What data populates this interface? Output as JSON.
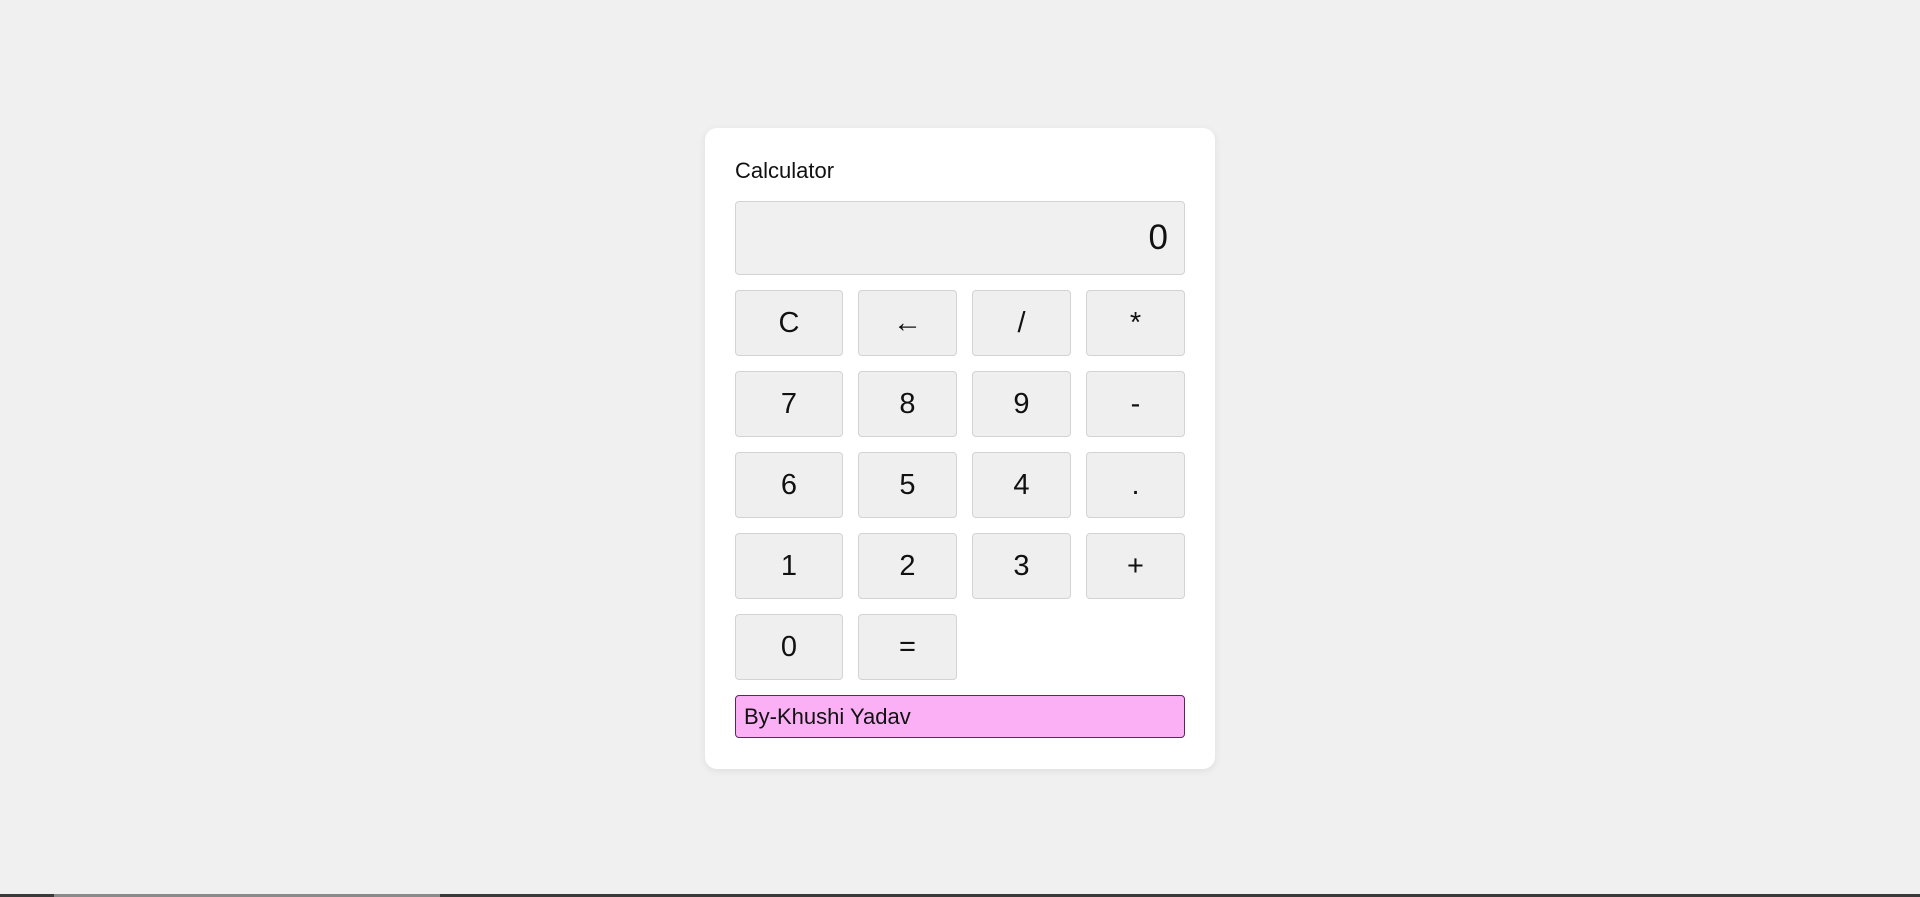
{
  "calculator": {
    "title": "Calculator",
    "display_value": "0",
    "buttons": {
      "clear": "C",
      "backspace": "←",
      "divide": "/",
      "multiply": "*",
      "seven": "7",
      "eight": "8",
      "nine": "9",
      "minus": "-",
      "six": "6",
      "five": "5",
      "four": "4",
      "decimal": ".",
      "one": "1",
      "two": "2",
      "three": "3",
      "plus": "+",
      "zero": "0",
      "equals": "="
    },
    "credit": "By-Khushi Yadav"
  },
  "colors": {
    "page_background": "#f0f0f0",
    "card_background": "#ffffff",
    "button_background": "#efefef",
    "credit_background": "#fbb0f6"
  }
}
